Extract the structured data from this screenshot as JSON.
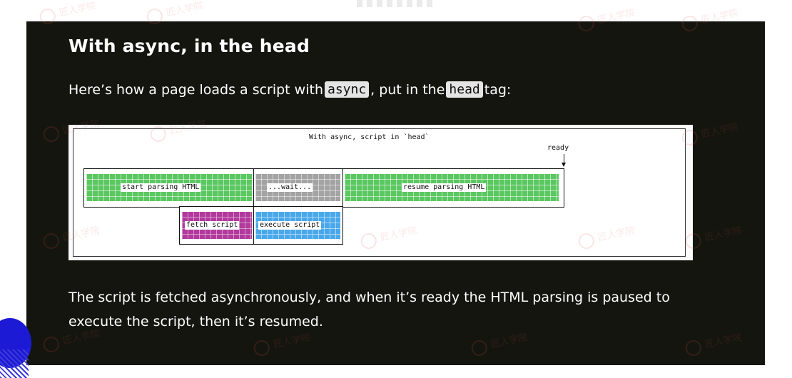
{
  "slide": {
    "heading": "With async, in the head",
    "intro_before": "Here’s how a page loads a script with ",
    "intro_code1": "async",
    "intro_middle": ", put in the ",
    "intro_code2": "head",
    "intro_after": " tag:",
    "outro": "The script is fetched asynchronously, and when it’s ready the HTML parsing is paused to execute the script, then it’s resumed."
  },
  "diagram": {
    "title": "With async, script in `head`",
    "ready_label": "ready",
    "main_track": {
      "segments": [
        {
          "label": "start parsing HTML",
          "color": "#5bc761"
        },
        {
          "label": "...wait...",
          "color": "#a3a3a3"
        },
        {
          "label": "resume parsing HTML",
          "color": "#5bc761"
        }
      ]
    },
    "script_track": {
      "segments": [
        {
          "label": "fetch script",
          "color": "#b23a9d"
        },
        {
          "label": "execute script",
          "color": "#4aa8ea"
        }
      ]
    }
  },
  "watermark": {
    "text": "匠人学院"
  },
  "colors": {
    "slide_background": "#14150f",
    "code_background": "#e4e4e4",
    "decoration_blue": "#1d1ad6"
  }
}
